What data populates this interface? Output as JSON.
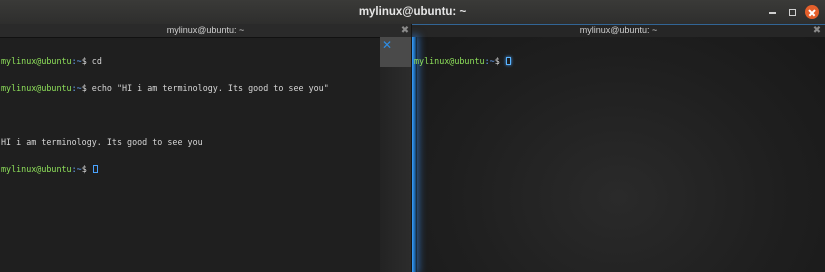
{
  "window": {
    "title": "mylinux@ubuntu: ~"
  },
  "left_pane": {
    "title": "mylinux@ubuntu: ~",
    "close_glyph": "✖",
    "tab_close_glyph": "✕",
    "lines": [
      {
        "user": "mylinux@ubuntu",
        "path": ":~",
        "symbol": "$",
        "command": " cd"
      },
      {
        "user": "mylinux@ubuntu",
        "path": ":~",
        "symbol": "$",
        "command": " echo \"HI i am terminology. Its good to see you\""
      },
      {
        "output": ""
      },
      {
        "output": "HI i am terminology. Its good to see you"
      },
      {
        "user": "mylinux@ubuntu",
        "path": ":~",
        "symbol": "$",
        "command": " "
      }
    ]
  },
  "right_pane": {
    "title": "mylinux@ubuntu: ~",
    "close_glyph": "✖",
    "lines": [
      {
        "user": "mylinux@ubuntu",
        "path": ":~",
        "symbol": "$",
        "command": " "
      }
    ]
  },
  "colors": {
    "prompt_user": "#8ee05a",
    "prompt_path": "#6aa9ff",
    "accent_glow": "#3aa0ff",
    "close_button": "#e45f2b"
  }
}
